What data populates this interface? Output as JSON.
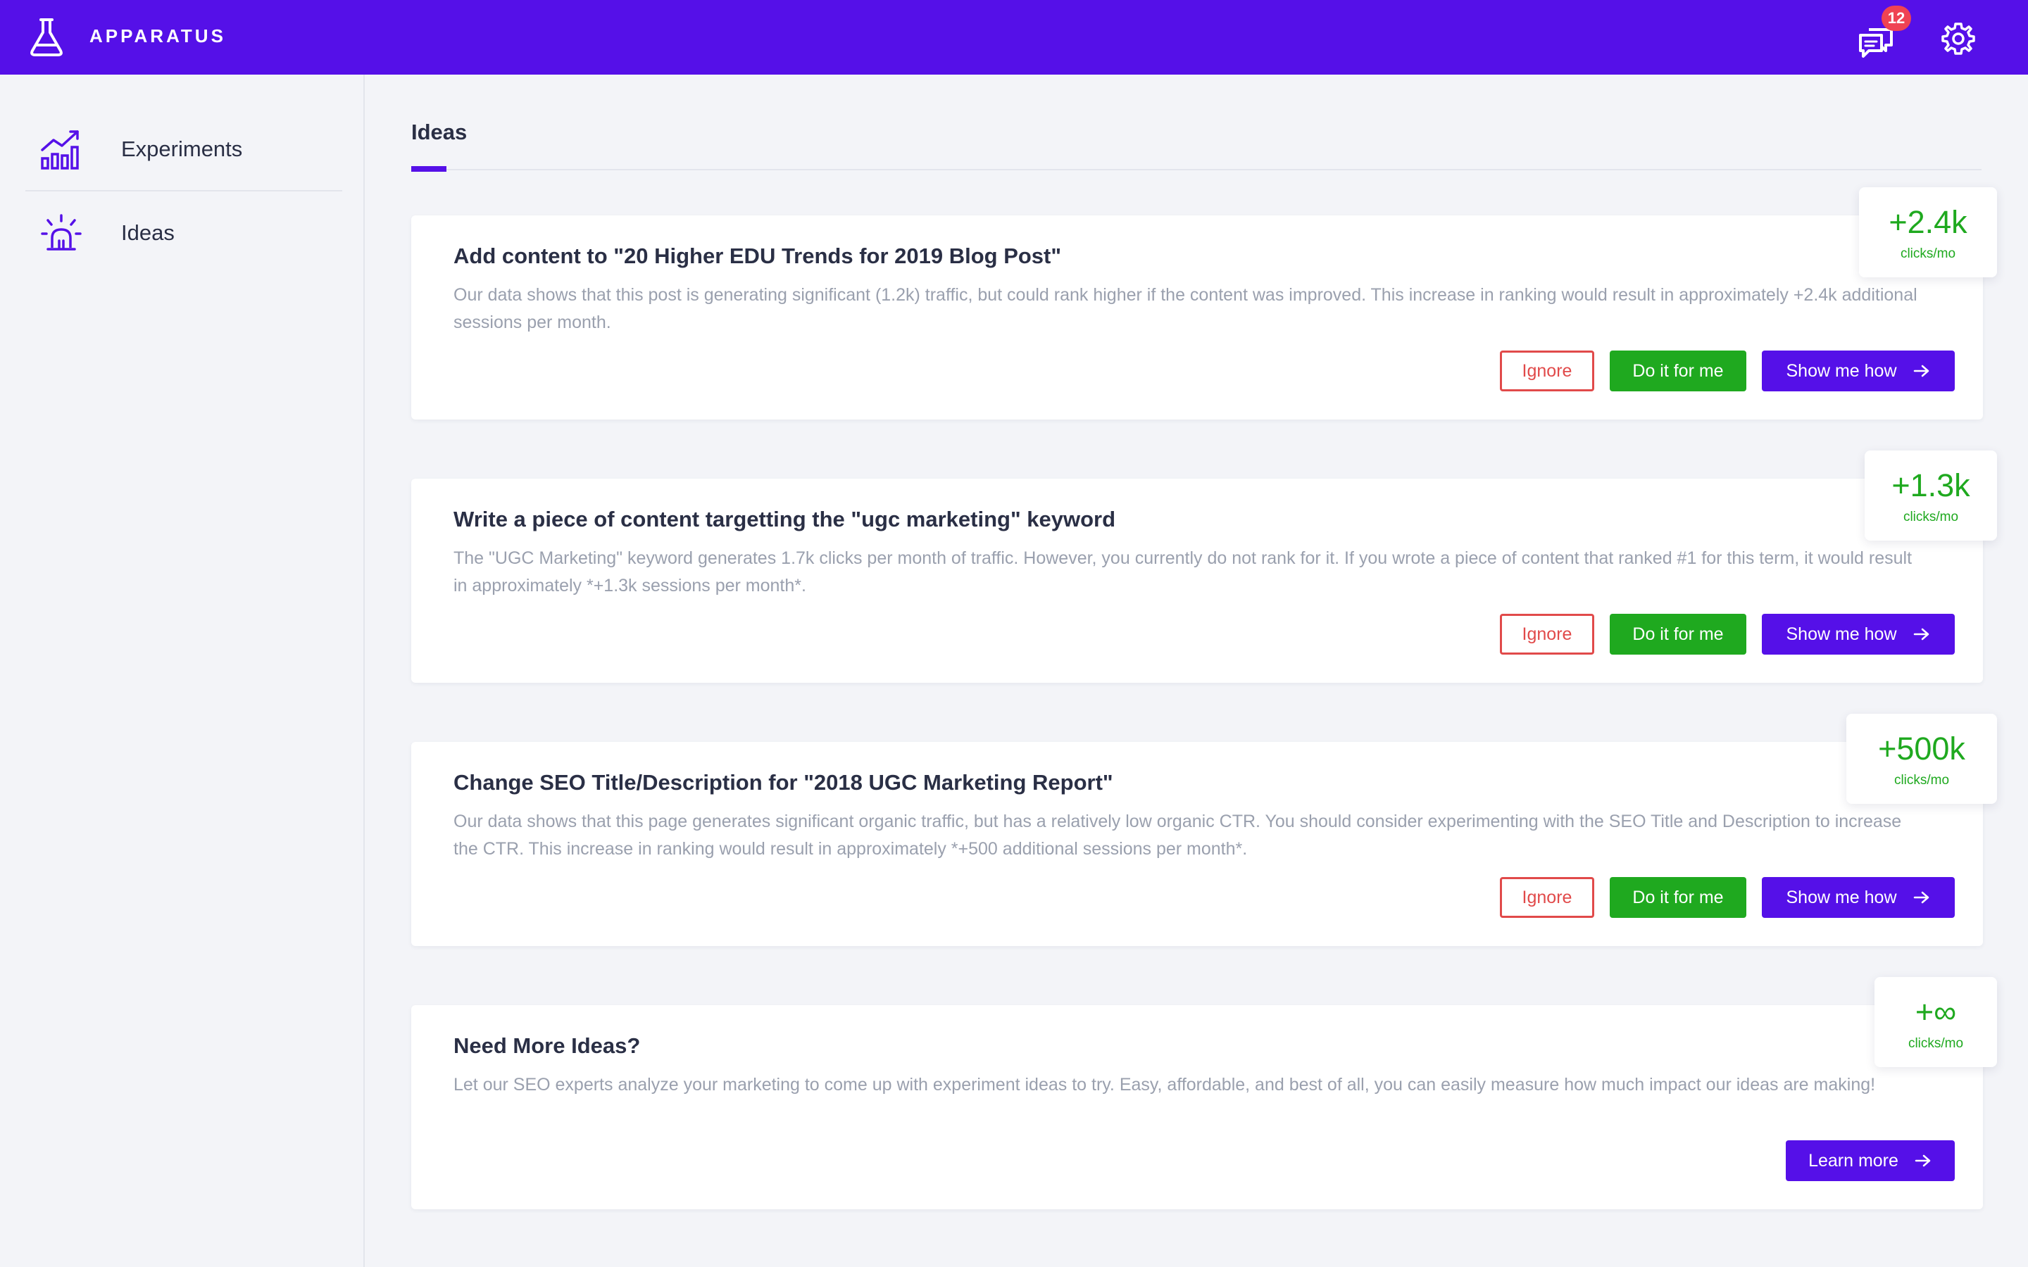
{
  "app": {
    "title": "APPARATUS",
    "notification_count": "12"
  },
  "sidebar": {
    "items": [
      {
        "label": "Experiments",
        "icon": "chart-growth-icon"
      },
      {
        "label": "Ideas",
        "icon": "lightbulb-icon"
      }
    ]
  },
  "main": {
    "title": "Ideas",
    "cards": [
      {
        "title": "Add content to \"20 Higher EDU Trends for 2019 Blog Post\"",
        "description": "Our data shows that this post is generating significant (1.2k) traffic, but could rank higher if the content was improved. This increase in ranking would result in approximately +2.4k additional sessions per month.",
        "metric_value": "+2.4k",
        "metric_unit": "clicks/mo",
        "ignore_label": "Ignore",
        "do_label": "Do it for me",
        "show_label": "Show me how"
      },
      {
        "title": "Write a piece of content targetting the \"ugc marketing\" keyword",
        "description": "The \"UGC Marketing\" keyword generates 1.7k clicks per month of traffic. However, you currently do not rank for it. If you wrote a piece of content that ranked #1 for this term, it would result in approximately *+1.3k sessions per month*.",
        "metric_value": "+1.3k",
        "metric_unit": "clicks/mo",
        "ignore_label": "Ignore",
        "do_label": "Do it for me",
        "show_label": "Show me how"
      },
      {
        "title": "Change SEO Title/Description for \"2018 UGC Marketing Report\"",
        "description": "Our data shows that this page generates significant organic traffic, but has a relatively low organic CTR. You should consider experimenting with the SEO Title and Description to increase the CTR. This increase in ranking would result in approximately *+500 additional sessions per month*.",
        "metric_value": "+500k",
        "metric_unit": "clicks/mo",
        "ignore_label": "Ignore",
        "do_label": "Do it for me",
        "show_label": "Show me how"
      },
      {
        "title": "Need More Ideas?",
        "description": "Let our SEO experts analyze your marketing to come up with experiment ideas to try. Easy, affordable, and best of all, you can easily measure how much impact our ideas are making!",
        "metric_value": "+∞",
        "metric_unit": "clicks/mo",
        "learn_label": "Learn more"
      }
    ]
  },
  "colors": {
    "brand": "#5510e8",
    "success": "#1fa91f",
    "danger": "#e14a4a",
    "badge": "#ef4353"
  }
}
